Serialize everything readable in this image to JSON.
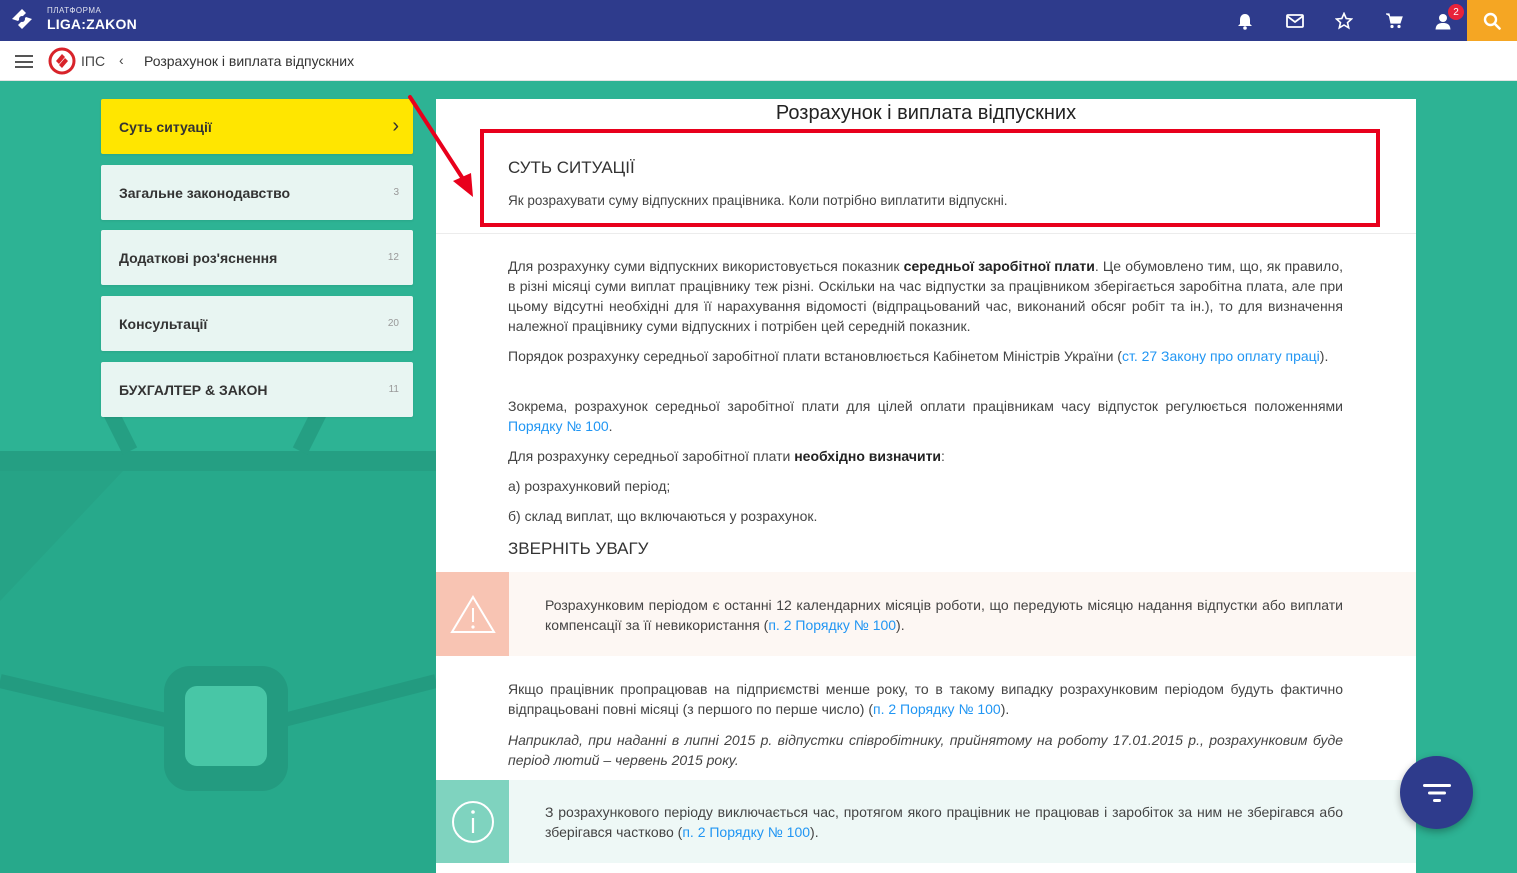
{
  "topbar": {
    "logo_small": "ПЛАТФОРМА",
    "logo_big": "LIGA:ZAKON",
    "icons": [
      "bell-icon",
      "mail-icon",
      "star-icon",
      "cart-icon",
      "user-icon",
      "search-icon"
    ],
    "user_badge": "2",
    "colors": {
      "bar": "#2e3b8c",
      "search": "#f5a623",
      "badge": "#e8233a"
    }
  },
  "breadcrumb": {
    "ips_label": "ІПС",
    "chevron": "‹",
    "title": "Розрахунок і виплата відпускних"
  },
  "sidebar": {
    "items": [
      {
        "label": "Суть ситуації",
        "count": "",
        "active": true
      },
      {
        "label": "Загальне законодавство",
        "count": "3",
        "active": false
      },
      {
        "label": "Додаткові роз'яснення",
        "count": "12",
        "active": false
      },
      {
        "label": "Консультації",
        "count": "20",
        "active": false
      },
      {
        "label": "БУХГАЛТЕР & ЗАКОН",
        "count": "11",
        "active": false
      }
    ]
  },
  "document": {
    "title": "Розрахунок і виплата відпускних",
    "summary_heading": "СУТЬ СИТУАЦІЇ",
    "summary_text": "Як розрахувати суму відпускних працівника. Коли потрібно виплатити відпускні.",
    "p1_a": "Для розрахунку суми відпускних використовується показник ",
    "p1_bold": "середньої заробітної плати",
    "p1_b": ". Це обумовлено тим, що, як правило, в різні місяці суми виплат працівнику теж різні. Оскільки на час відпустки за працівником зберігається заробітна плата, але при цьому відсутні необхідні для її нарахування відомості (відпрацьований час, виконаний обсяг робіт та ін.), то для визначення належної працівнику суми відпускних і потрібен цей середній показник.",
    "p2_a": "Порядок розрахунку середньої заробітної плати встановлюється Кабінетом Міністрів України (",
    "p2_link": "ст. 27 Закону про оплату праці",
    "p2_b": ").",
    "p3_a": "Зокрема, розрахунок середньої заробітної плати для цілей оплати працівникам часу відпусток регулюється положеннями ",
    "p3_link": "Порядку № 100",
    "p3_b": ".",
    "p4_a": "Для розрахунку середньої заробітної плати ",
    "p4_bold": "необхідно визначити",
    "p4_b": ":",
    "p5": "а) розрахунковий період;",
    "p6": "б) склад виплат, що включаються у розрахунок.",
    "attention_heading": "ЗВЕРНІТЬ УВАГУ",
    "warn_a": "Розрахунковим періодом є останні 12 календарних місяців роботи, що передують місяцю надання відпустки або виплати компенсації за її невикористання (",
    "warn_link": "п. 2 Порядку № 100",
    "warn_b": ").",
    "p7_a": "Якщо працівник пропрацював на підприємстві менше року, то в такому випадку розрахунковим періодом будуть фактично відпрацьовані повні місяці (з першого по перше число) (",
    "p7_link": "п. 2 Порядку № 100",
    "p7_b": ").",
    "example": "Наприклад, при наданні в липні 2015 р. відпустки співробітнику, прийнятому на роботу 17.01.2015 р., розрахунковим буде період лютий – червень 2015 року.",
    "info_a": "З розрахункового періоду виключається час, протягом якого працівник не працював і заробіток за ним не зберігався або зберігався частково (",
    "info_link": "п. 2 Порядку № 100",
    "info_b": ")."
  },
  "fab": {
    "icon": "filter-icon"
  }
}
